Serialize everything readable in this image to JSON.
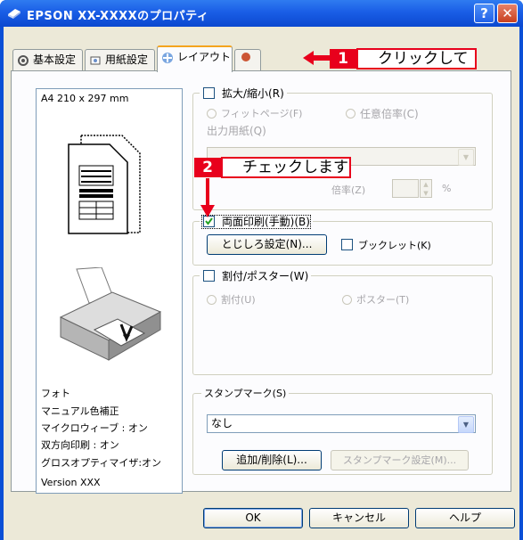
{
  "window": {
    "title": "EPSON XX-XXXXのプロパティ",
    "help_button": "?",
    "close_button": "✕"
  },
  "tabs": [
    {
      "label": "基本設定"
    },
    {
      "label": "用紙設定"
    },
    {
      "label": "レイアウト"
    }
  ],
  "preview": {
    "paper": "A4 210 x 297 mm",
    "lines": [
      "フォト",
      "マニュアル色補正",
      "マイクロウィーブ : オン",
      "双方向印刷 : オン",
      "グロスオプティマイザ:オン"
    ],
    "version": "Version XXX"
  },
  "scale_group": {
    "title": "拡大/縮小(R)",
    "fit_page": "フィットページ(F)",
    "any_ratio": "任意倍率(C)",
    "output_paper": "出力用紙(Q)",
    "ratio_label": "倍率(Z)",
    "percent": "%"
  },
  "duplex": {
    "title": "両面印刷(手動)(B)",
    "margin_button": "とじしろ設定(N)...",
    "booklet": "ブックレット(K)"
  },
  "poster_group": {
    "title": "割付/ポスター(W)",
    "split": "割付(U)",
    "poster": "ポスター(T)"
  },
  "stamp_group": {
    "title": "スタンプマーク(S)",
    "selected": "なし",
    "add_delete": "追加/削除(L)...",
    "settings": "スタンプマーク設定(M)..."
  },
  "footer": {
    "ok": "OK",
    "cancel": "キャンセル",
    "help": "ヘルプ"
  },
  "callouts": [
    {
      "num": "1",
      "text": "クリックして"
    },
    {
      "num": "2",
      "text": "チェックします"
    }
  ],
  "colors": {
    "titlebar": "#0b48cf",
    "callout_red": "#e8001c",
    "dialog_bg": "#ece9d8"
  }
}
